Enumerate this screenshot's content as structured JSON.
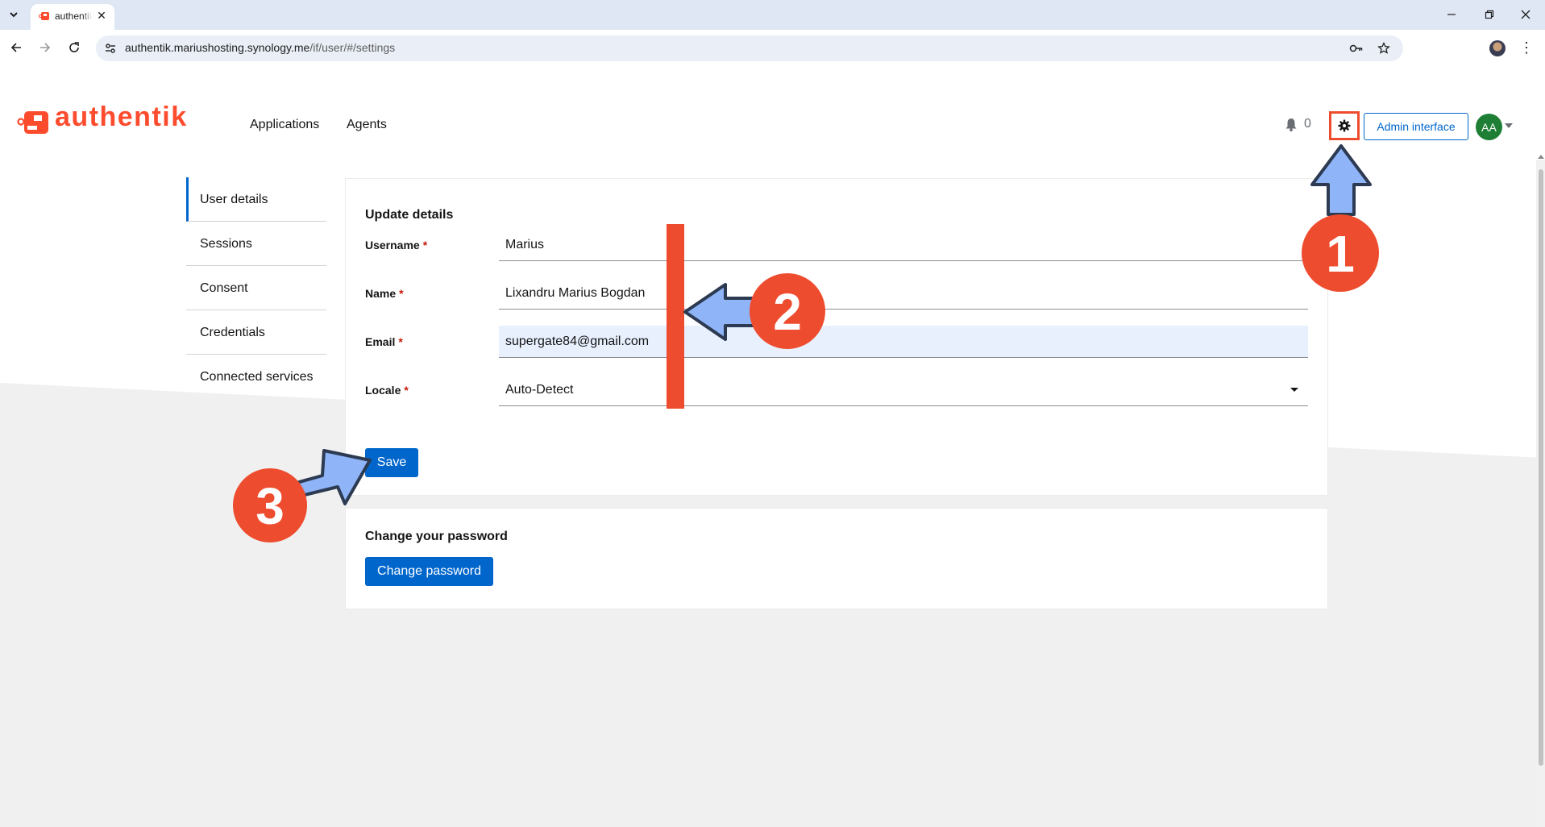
{
  "browser": {
    "tab_title": "authentik",
    "url_host": "authentik.mariushosting.synology.me",
    "url_path": "/if/user/#/settings"
  },
  "header": {
    "logo_text": "authentik",
    "nav": [
      "Applications",
      "Agents"
    ],
    "notification_count": "0",
    "admin_button": "Admin interface",
    "avatar_initials": "AA"
  },
  "sidebar": {
    "items": [
      {
        "label": "User details",
        "active": true
      },
      {
        "label": "Sessions"
      },
      {
        "label": "Consent"
      },
      {
        "label": "Credentials"
      },
      {
        "label": "Connected services"
      }
    ]
  },
  "update_details": {
    "title": "Update details",
    "fields": [
      {
        "label": "Username",
        "value": "Marius"
      },
      {
        "label": "Name",
        "value": "Lixandru Marius Bogdan"
      },
      {
        "label": "Email",
        "value": "supergate84@gmail.com"
      },
      {
        "label": "Locale",
        "value": "Auto-Detect"
      }
    ],
    "required_marker": "*",
    "save_button": "Save"
  },
  "change_password": {
    "title": "Change your password",
    "button": "Change password"
  },
  "annotations": {
    "steps": [
      "1",
      "2",
      "3"
    ]
  },
  "colors": {
    "brand": "#fd4b2d",
    "primary": "#0066cc",
    "annotation_badge": "#ee4c2e",
    "annotation_arrow": "#8fb4f8"
  }
}
